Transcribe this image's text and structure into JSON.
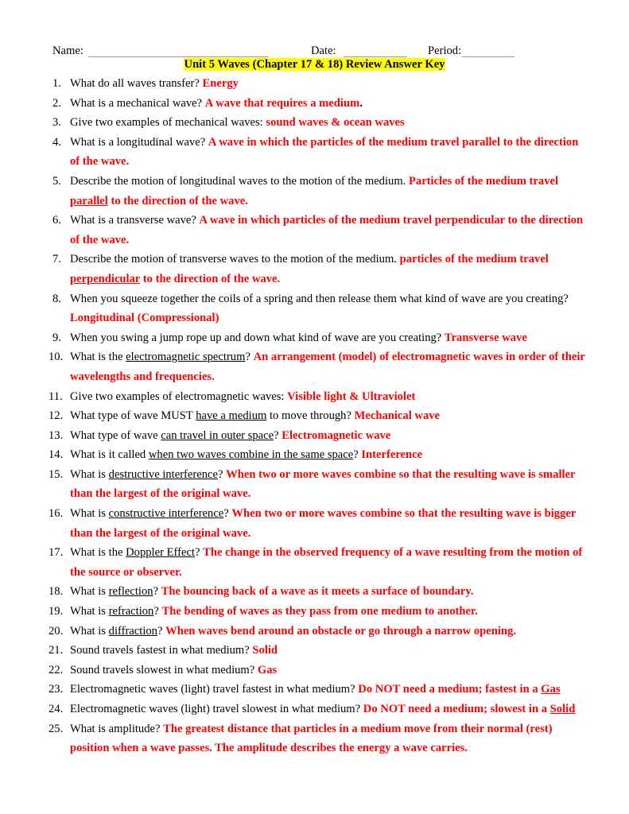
{
  "header": {
    "name_label": "Name:",
    "date_label": "Date:",
    "period_label": "Period:",
    "title": "Unit 5 Waves (Chapter 17 & 18) Review Answer Key",
    "title_highlight": "#ffff00"
  },
  "colors": {
    "answer": "#ff0000",
    "question": "#000000"
  },
  "questions": [
    {
      "num": "1.",
      "segments": [
        {
          "t": "What do all waves transfer? ",
          "s": "plain"
        },
        {
          "t": "Energy",
          "s": "ans"
        }
      ]
    },
    {
      "num": "2.",
      "segments": [
        {
          "t": "What is a mechanical wave? ",
          "s": "plain"
        },
        {
          "t": "A wave that requires a medium",
          "s": "ans"
        },
        {
          "t": ".",
          "s": "blackbold"
        }
      ]
    },
    {
      "num": "3.",
      "segments": [
        {
          "t": "Give two examples of mechanical waves: ",
          "s": "plain"
        },
        {
          "t": "sound waves & ocean waves",
          "s": "ans"
        }
      ]
    },
    {
      "num": "4.",
      "segments": [
        {
          "t": "What is a longitudinal wave? ",
          "s": "plain"
        },
        {
          "t": "A wave in which the particles of the medium travel parallel to the direction of the wave.",
          "s": "ans"
        }
      ]
    },
    {
      "num": "5.",
      "segments": [
        {
          "t": "Describe the motion of longitudinal waves to the motion of the medium.  ",
          "s": "plain"
        },
        {
          "t": "Particles of the medium travel ",
          "s": "ans"
        },
        {
          "t": "parallel",
          "s": "ans-u"
        },
        {
          "t": " to the direction of the wave.",
          "s": "ans"
        }
      ]
    },
    {
      "num": "6.",
      "segments": [
        {
          "t": "What is a transverse wave? ",
          "s": "plain"
        },
        {
          "t": "A wave in which particles of the medium travel perpendicular to the direction of the wave.",
          "s": "ans"
        }
      ]
    },
    {
      "num": "7.",
      "segments": [
        {
          "t": "Describe the motion of transverse waves to the motion of the medium.  ",
          "s": "plain"
        },
        {
          "t": "particles of the medium travel ",
          "s": "ans"
        },
        {
          "t": "perpendicular",
          "s": "ans-u"
        },
        {
          "t": " to the direction of the wave.",
          "s": "ans"
        }
      ]
    },
    {
      "num": "8.",
      "segments": [
        {
          "t": "When you squeeze together the coils of a spring and then release them what kind of wave are you creating? ",
          "s": "plain"
        },
        {
          "t": "Longitudinal (Compressional)",
          "s": "ans"
        }
      ]
    },
    {
      "num": "9.",
      "segments": [
        {
          "t": "When you swing a jump rope up and down what kind of wave are you creating? ",
          "s": "plain"
        },
        {
          "t": "Transverse wave",
          "s": "ans"
        }
      ]
    },
    {
      "num": "10.",
      "segments": [
        {
          "t": "What is the ",
          "s": "plain"
        },
        {
          "t": "electromagnetic spectrum",
          "s": "u"
        },
        {
          "t": "? ",
          "s": "plain"
        },
        {
          "t": "An arrangement (model) of electromagnetic waves in order of their wavelengths and frequencies.",
          "s": "ans"
        }
      ]
    },
    {
      "num": "11.",
      "segments": [
        {
          "t": "Give two examples of electromagnetic waves: ",
          "s": "plain"
        },
        {
          "t": "Visible light & Ultraviolet",
          "s": "ans"
        }
      ]
    },
    {
      "num": "12.",
      "segments": [
        {
          "t": "What type of wave MUST ",
          "s": "plain"
        },
        {
          "t": "have a medium",
          "s": "u"
        },
        {
          "t": " to move through? ",
          "s": "plain"
        },
        {
          "t": "Mechanical wave",
          "s": "ans"
        }
      ]
    },
    {
      "num": "13.",
      "segments": [
        {
          "t": "What type of wave ",
          "s": "plain"
        },
        {
          "t": "can travel in outer space",
          "s": "u"
        },
        {
          "t": "? ",
          "s": "plain"
        },
        {
          "t": "Electromagnetic wave",
          "s": "ans"
        }
      ]
    },
    {
      "num": "14.",
      "segments": [
        {
          "t": "What is it called ",
          "s": "plain"
        },
        {
          "t": "when two waves combine in the same space",
          "s": "u"
        },
        {
          "t": "? ",
          "s": "plain"
        },
        {
          "t": "Interference",
          "s": "ans"
        }
      ]
    },
    {
      "num": "15.",
      "segments": [
        {
          "t": "What is ",
          "s": "plain"
        },
        {
          "t": "destructive interference",
          "s": "u"
        },
        {
          "t": "? ",
          "s": "plain"
        },
        {
          "t": "When two or more waves combine so that the resulting wave is smaller than the largest of the original wave.",
          "s": "ans"
        }
      ]
    },
    {
      "num": "16.",
      "segments": [
        {
          "t": "What is ",
          "s": "plain"
        },
        {
          "t": "constructive interference",
          "s": "u"
        },
        {
          "t": "? ",
          "s": "plain"
        },
        {
          "t": "When two or more waves combine so that the resulting wave is bigger than the largest of the original wave.",
          "s": "ans"
        }
      ]
    },
    {
      "num": "17.",
      "segments": [
        {
          "t": "What is the ",
          "s": "plain"
        },
        {
          "t": "Doppler Effect",
          "s": "u"
        },
        {
          "t": "? ",
          "s": "plain"
        },
        {
          "t": "The change in the observed frequency of a wave resulting from the motion of the source or observer.",
          "s": "ans"
        }
      ]
    },
    {
      "num": "18.",
      "segments": [
        {
          "t": "What is ",
          "s": "plain"
        },
        {
          "t": "reflection",
          "s": "u"
        },
        {
          "t": "? ",
          "s": "plain"
        },
        {
          "t": "The bouncing back of a wave as it meets a surface of boundary.",
          "s": "ans"
        }
      ]
    },
    {
      "num": "19.",
      "segments": [
        {
          "t": "What is ",
          "s": "plain"
        },
        {
          "t": "refraction",
          "s": "u"
        },
        {
          "t": "? ",
          "s": "plain"
        },
        {
          "t": "The bending of waves as they pass from one medium to another.",
          "s": "ans"
        }
      ]
    },
    {
      "num": "20.",
      "segments": [
        {
          "t": "What is ",
          "s": "plain"
        },
        {
          "t": "diffraction",
          "s": "u"
        },
        {
          "t": "? ",
          "s": "plain"
        },
        {
          "t": "When waves bend around an obstacle or go through a narrow opening.",
          "s": "ans"
        }
      ]
    },
    {
      "num": "21.",
      "segments": [
        {
          "t": "Sound travels fastest in what medium? ",
          "s": "plain"
        },
        {
          "t": "Solid",
          "s": "ans"
        }
      ]
    },
    {
      "num": "22.",
      "segments": [
        {
          "t": "Sound travels slowest in what medium? ",
          "s": "plain"
        },
        {
          "t": "Gas",
          "s": "ans"
        }
      ]
    },
    {
      "num": "23.",
      "segments": [
        {
          "t": "Electromagnetic waves (light) travel fastest in what medium? ",
          "s": "plain"
        },
        {
          "t": "Do NOT need a medium; fastest in a ",
          "s": "ans"
        },
        {
          "t": "Gas",
          "s": "ans-u"
        }
      ]
    },
    {
      "num": "24.",
      "segments": [
        {
          "t": "Electromagnetic waves (light) travel slowest in what medium?  ",
          "s": "plain"
        },
        {
          "t": "Do NOT need a medium; slowest in a ",
          "s": "ans"
        },
        {
          "t": "Solid",
          "s": "ans-u"
        }
      ]
    },
    {
      "num": "25.",
      "segments": [
        {
          "t": "What is amplitude? ",
          "s": "plain"
        },
        {
          "t": "The greatest distance that particles in a medium move from their normal (rest) position when a wave passes. The amplitude describes the energy a wave carries.",
          "s": "ans"
        }
      ]
    }
  ]
}
